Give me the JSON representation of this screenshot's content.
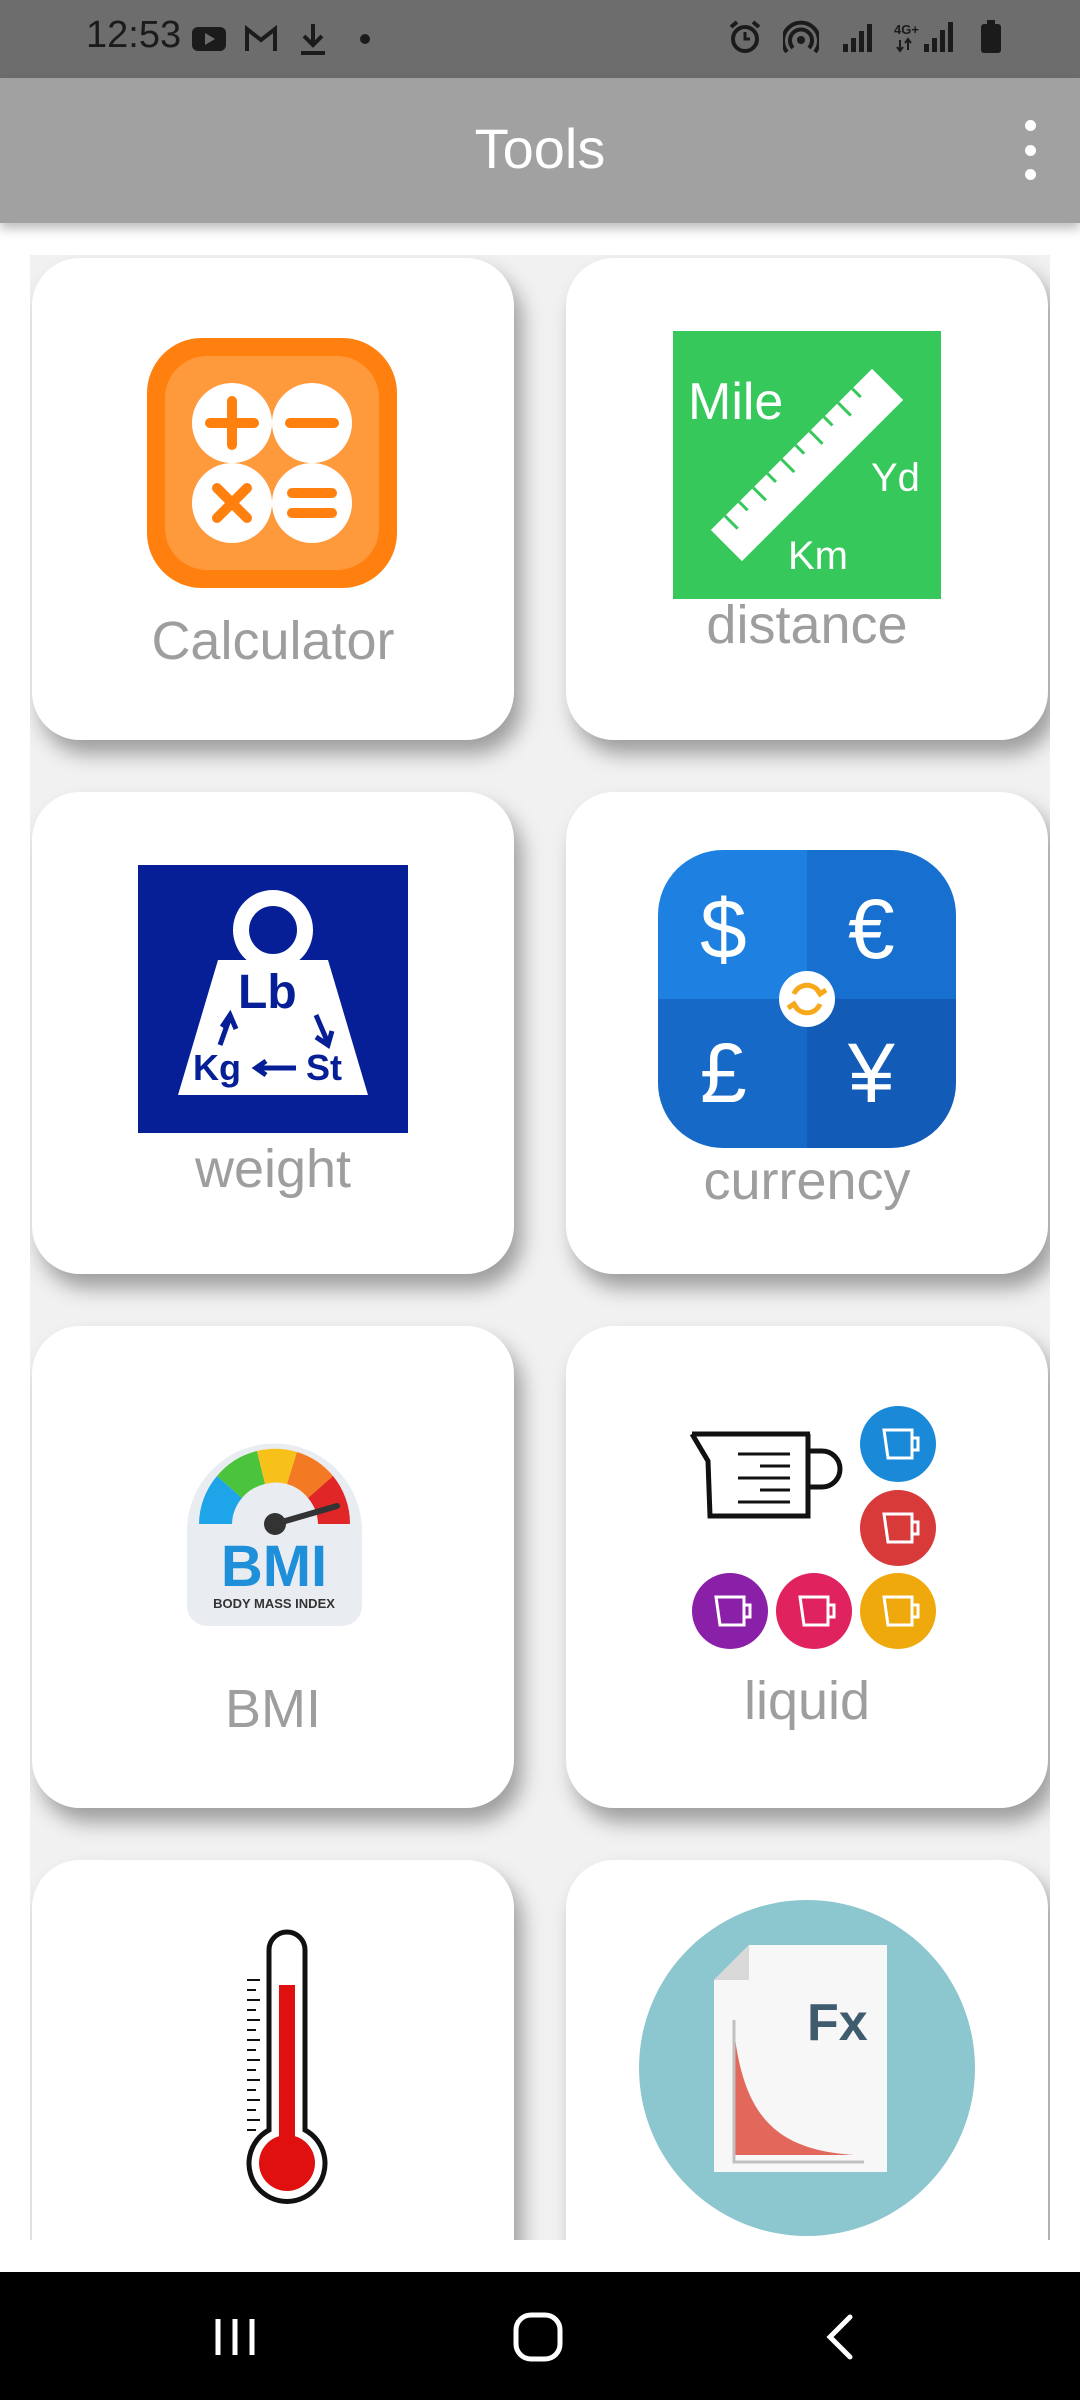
{
  "status_bar": {
    "time": "12:53",
    "left_icons": [
      "youtube-icon",
      "gmail-icon",
      "download-icon",
      "dot-icon"
    ],
    "right_icons": [
      "alarm-icon",
      "hotspot-icon",
      "signal-icon",
      "4g-signal-icon",
      "battery-icon"
    ],
    "network_label": "4G+"
  },
  "app_bar": {
    "title": "Tools",
    "menu_icon": "more-vertical-icon"
  },
  "tools": [
    {
      "label": "Calculator",
      "icon": "calculator-icon"
    },
    {
      "label": "distance",
      "icon": "ruler-icon",
      "icon_text": [
        "Mile",
        "Yd",
        "Km"
      ]
    },
    {
      "label": "weight",
      "icon": "weight-icon",
      "icon_text": [
        "Lb",
        "Kg",
        "St"
      ]
    },
    {
      "label": "currency",
      "icon": "currency-icon",
      "icon_text": [
        "$",
        "€",
        "£",
        "¥"
      ]
    },
    {
      "label": "BMI",
      "icon": "bmi-gauge-icon",
      "icon_text": [
        "BMI",
        "BODY MASS INDEX"
      ]
    },
    {
      "label": "liquid",
      "icon": "measuring-jug-icon"
    },
    {
      "label": "",
      "icon": "thermometer-icon"
    },
    {
      "label": "",
      "icon": "function-chart-icon",
      "icon_text": [
        "Fx"
      ]
    }
  ],
  "nav_bar": {
    "buttons": [
      "recent-apps-icon",
      "home-icon",
      "back-icon"
    ]
  },
  "colors": {
    "status_bar": "#6d6d6d",
    "app_bar": "#a1a1a1",
    "tile_label": "#9e9e9e",
    "calculator_orange": "#ff7f0f",
    "distance_green": "#37c85c",
    "weight_navy": "#061f96",
    "currency_blue": "#1c72d6",
    "fx_circle": "#8cc6ce"
  }
}
